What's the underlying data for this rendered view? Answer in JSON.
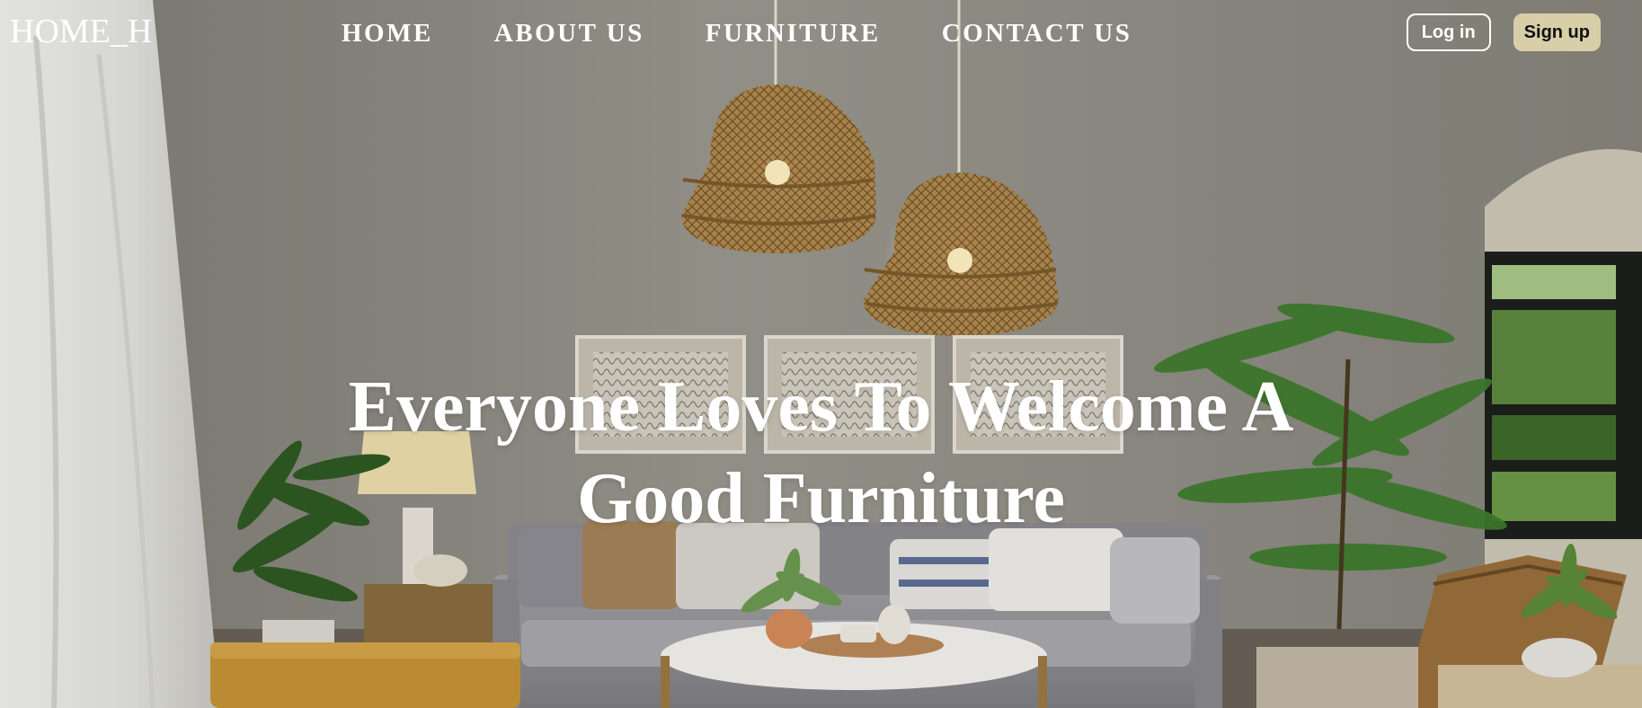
{
  "header": {
    "logo": "HOME_H",
    "nav": [
      {
        "label": "HOME"
      },
      {
        "label": "ABOUT US"
      },
      {
        "label": "FURNITURE"
      },
      {
        "label": "CONTACT US"
      }
    ],
    "login_label": "Log in",
    "signup_label": "Sign up"
  },
  "hero": {
    "title": "Everyone Loves To Welcome A Good Furniture"
  },
  "colors": {
    "text": "#ffffff",
    "signup_bg": "#d8cfa8",
    "wall": "#8f8d84"
  },
  "icons": {
    "background": "living-room-photo"
  }
}
